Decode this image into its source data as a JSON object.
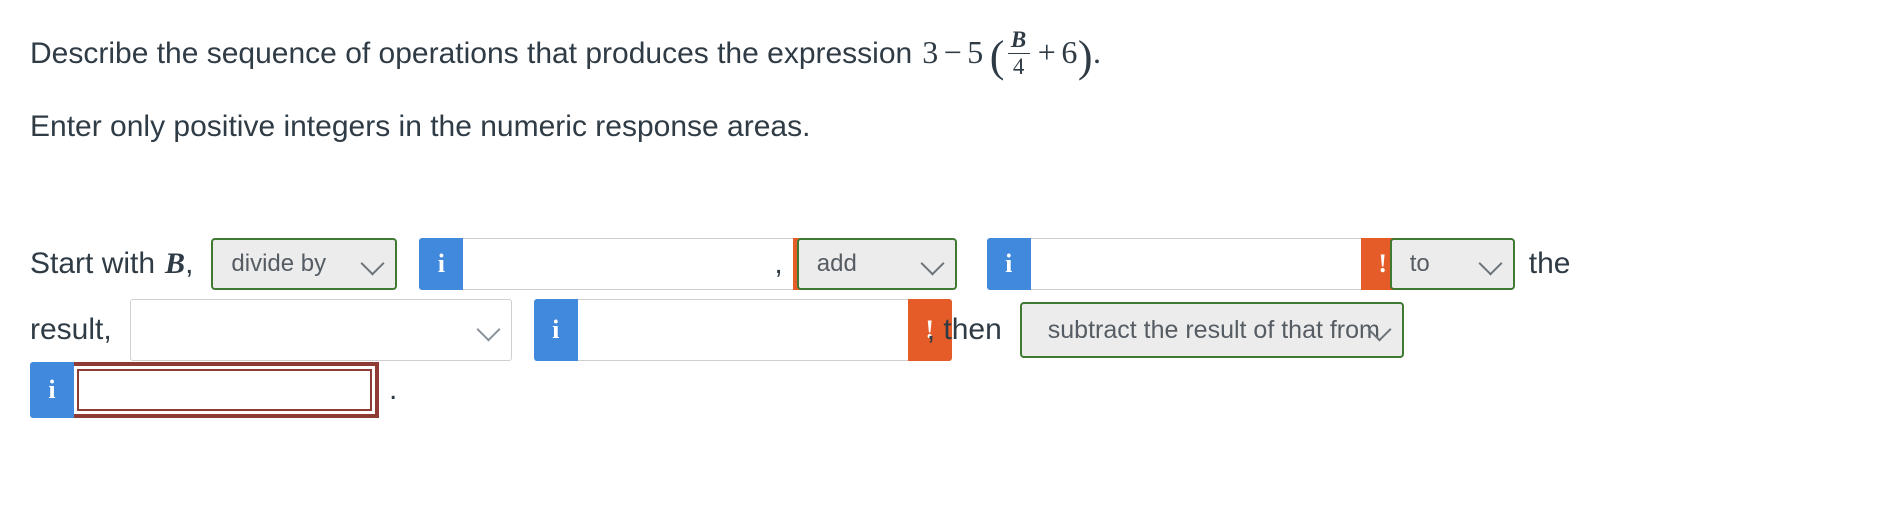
{
  "question": {
    "line1_before": "Describe the sequence of operations that produces the expression",
    "expression": {
      "lead_number": "3",
      "minus": "−",
      "multiplier": "5",
      "open_paren": "(",
      "fraction_numerator": "B",
      "fraction_denominator": "4",
      "plus": "+",
      "addend": "6",
      "close_paren": ")",
      "period": "."
    },
    "line2": "Enter only positive integers in the numeric response areas."
  },
  "answer": {
    "start_label": "Start with",
    "start_variable": "B",
    "start_comma": ",",
    "operation_1": "divide by",
    "comma_1": ",",
    "operation_2": "add",
    "trailing_the": "the",
    "result_label": "result,",
    "operation_3": "",
    "then_label": ", then",
    "operation_4": "subtract the result of that from",
    "final_period": "."
  },
  "inputs": {
    "numeric_1": "",
    "numeric_2": "",
    "numeric_3": "",
    "numeric_4": ""
  },
  "icons": {
    "info": "i",
    "alert": "!",
    "chevron": "chevron-down-icon"
  },
  "colors": {
    "info_blue": "#4189dd",
    "alert_orange": "#e55c28",
    "dropdown_green_border": "#3f7a33",
    "dropdown_fill": "#ececec",
    "incorrect_red": "#8e3b35",
    "text": "#2f3b45"
  }
}
